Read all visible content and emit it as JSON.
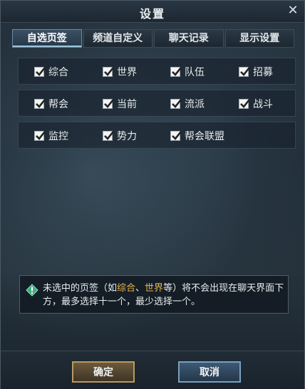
{
  "window": {
    "title": "设置",
    "close_symbol": "✕"
  },
  "tabs": [
    {
      "label": "自选页签",
      "active": true
    },
    {
      "label": "频道自定义",
      "active": false
    },
    {
      "label": "聊天记录",
      "active": false
    },
    {
      "label": "显示设置",
      "active": false
    }
  ],
  "channels": {
    "row1": [
      "综合",
      "世界",
      "队伍",
      "招募"
    ],
    "row2": [
      "帮会",
      "当前",
      "流派",
      "战斗"
    ],
    "row3": [
      "监控",
      "势力",
      "帮会联盟"
    ]
  },
  "tip": {
    "part1": "未选中的页签（如",
    "hl1": "综合",
    "sep": "、",
    "hl2": "世界",
    "part2": "等）将不会出现在聊天界面下方，最多选择十一个，最少选择一个。"
  },
  "buttons": {
    "confirm": "确定",
    "cancel": "取消"
  },
  "colors": {
    "highlight": "#e7b74a",
    "accent": "#9ec4dc"
  }
}
